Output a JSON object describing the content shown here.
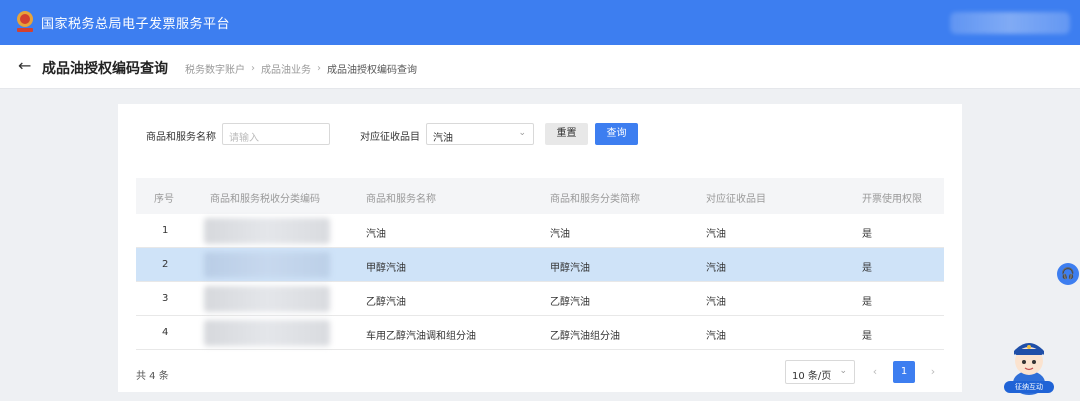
{
  "header": {
    "title": "国家税务总局电子发票服务平台",
    "emblem_icon": "tax-emblem-icon",
    "brand_color": "#3d7ef0"
  },
  "page": {
    "back_icon": "arrow-left-icon",
    "title": "成品油授权编码查询",
    "breadcrumb": [
      "税务数字账户",
      "成品油业务",
      "成品油授权编码查询"
    ]
  },
  "filters": {
    "name_label": "商品和服务名称",
    "name_placeholder": "请输入",
    "category_label": "对应征收品目",
    "category_value": "汽油",
    "reset_label": "重置",
    "query_label": "查询"
  },
  "table": {
    "columns": [
      "序号",
      "商品和服务税收分类编码",
      "商品和服务名称",
      "商品和服务分类简称",
      "对应征收品目",
      "开票使用权限"
    ],
    "rows": [
      {
        "index": "1",
        "name": "汽油",
        "short": "汽油",
        "category": "汽油",
        "permission": "是"
      },
      {
        "index": "2",
        "name": "甲醇汽油",
        "short": "甲醇汽油",
        "category": "汽油",
        "permission": "是"
      },
      {
        "index": "3",
        "name": "乙醇汽油",
        "short": "乙醇汽油",
        "category": "汽油",
        "permission": "是"
      },
      {
        "index": "4",
        "name": "车用乙醇汽油调和组分油",
        "short": "乙醇汽油组分油",
        "category": "汽油",
        "permission": "是"
      }
    ],
    "highlight_color": "#cfe3f8"
  },
  "pagination": {
    "total": "共 4 条",
    "page_size": "10 条/页",
    "current_page": "1"
  },
  "widgets": {
    "support_icon": "headset-icon",
    "mascot_label": "征纳互动"
  }
}
